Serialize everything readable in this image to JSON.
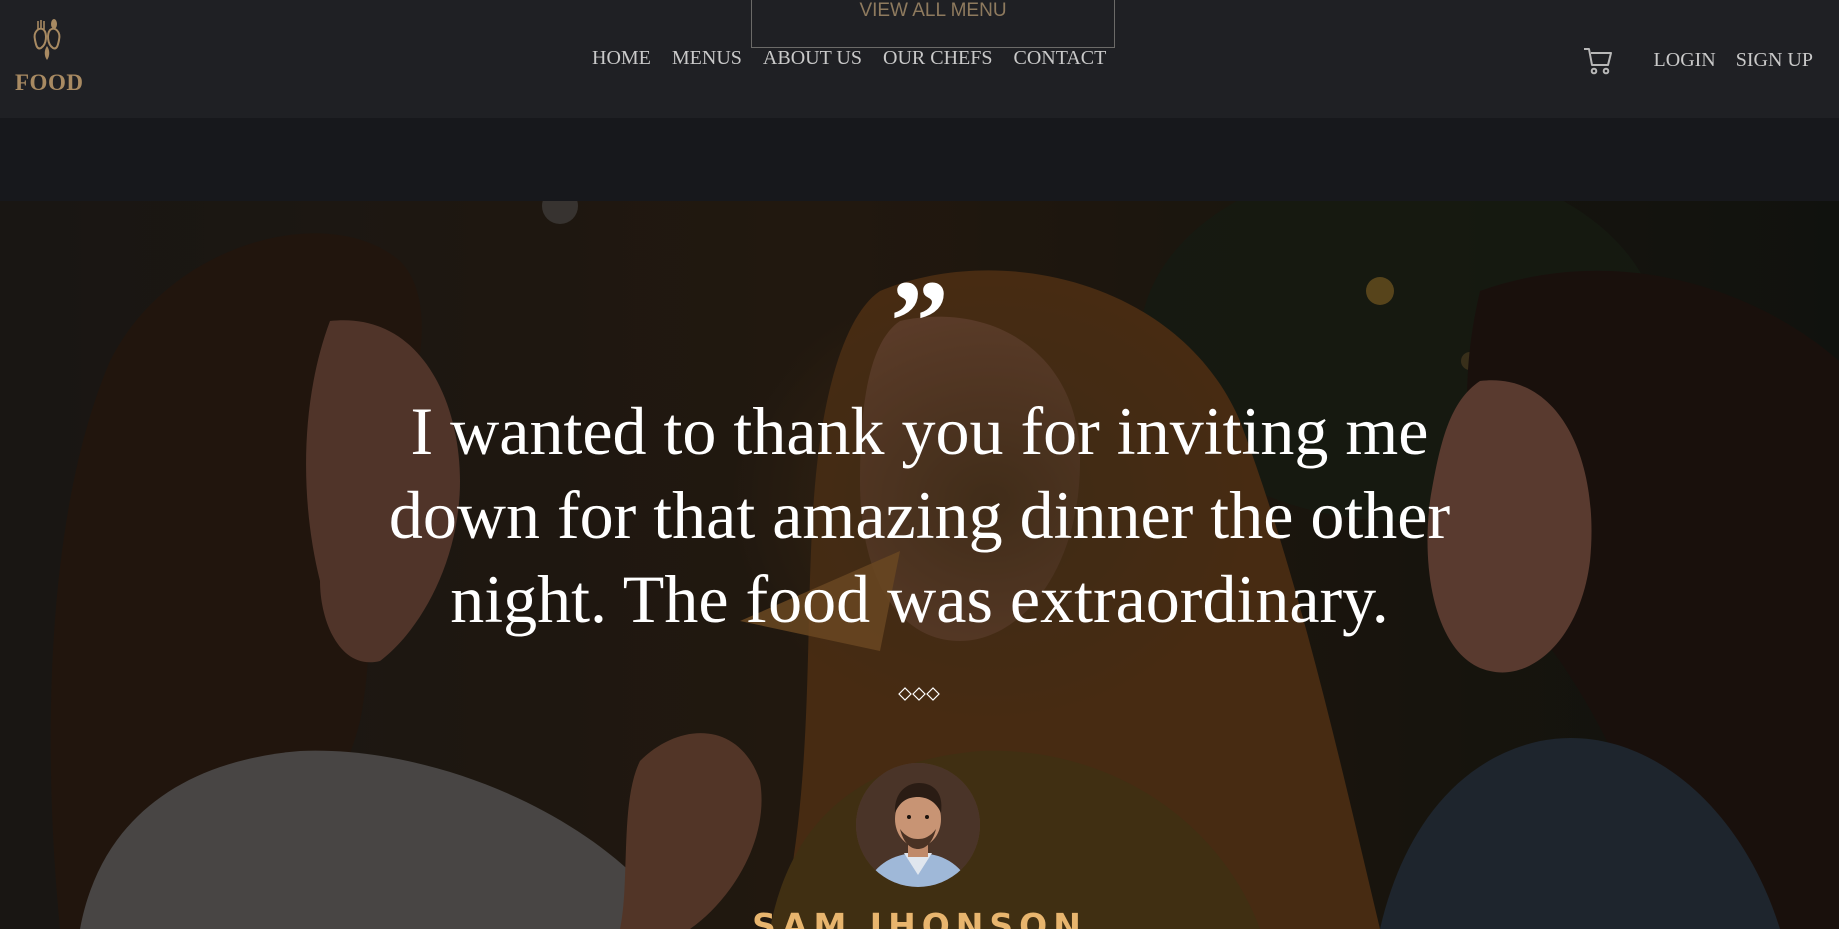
{
  "brand": {
    "logo_text": "FOOD",
    "accent_color": "#a88a62",
    "icon": "fork-spoon-logo-icon"
  },
  "header": {
    "view_all_menu": "VIEW ALL MENU",
    "nav": [
      "HOME",
      "MENUS",
      "ABOUT US",
      "OUR CHEFS",
      "CONTACT"
    ],
    "cart_icon": "cart-icon",
    "login": "LOGIN",
    "signup": "SIGN UP"
  },
  "testimonial": {
    "quote_mark": "”",
    "quote": "I wanted to thank you for inviting me down for that amazing dinner the other night. The food was extraordinary.",
    "divider_icon": "diamonds-divider-icon",
    "author": "SAM JHONSON",
    "author_color": "#e8b56e"
  }
}
